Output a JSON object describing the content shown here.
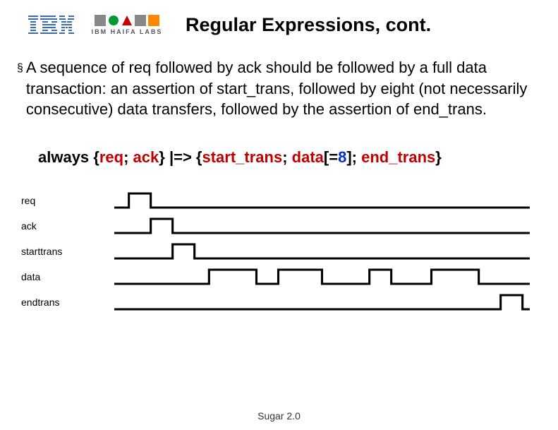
{
  "logos": {
    "ibm_alt": "IBM",
    "haifa_text": "IBM HAIFA LABS"
  },
  "title": "Regular Expressions, cont.",
  "bullet": "§",
  "paragraph": "A sequence of req followed by ack should be followed by a full data transaction:  an assertion of start_trans, followed by eight (not necessarily consecutive) data transfers, followed by the assertion of end_trans.",
  "code": {
    "t0": "always {",
    "t1": "req",
    "t2": "; ",
    "t3": "ack",
    "t4": "} |=> {",
    "t5": "start_trans",
    "t6": "; ",
    "t7": "data",
    "t8": "[=",
    "t9": "8",
    "t10": "]; ",
    "t11": "end_trans",
    "t12": "}"
  },
  "signals": {
    "req": {
      "label": "req"
    },
    "ack": {
      "label": "ack"
    },
    "starttrans": {
      "label": "starttrans"
    },
    "data": {
      "label": "data"
    },
    "endtrans": {
      "label": "endtrans"
    }
  },
  "footer": "Sugar 2.0",
  "colors": {
    "ibm_blue": "#3b6caa",
    "haifa_green": "#009933",
    "haifa_red": "#cc0000",
    "haifa_orange": "#ff8800",
    "haifa_gray": "#888888",
    "code_red": "#c00000",
    "code_blue": "#0033cc"
  }
}
